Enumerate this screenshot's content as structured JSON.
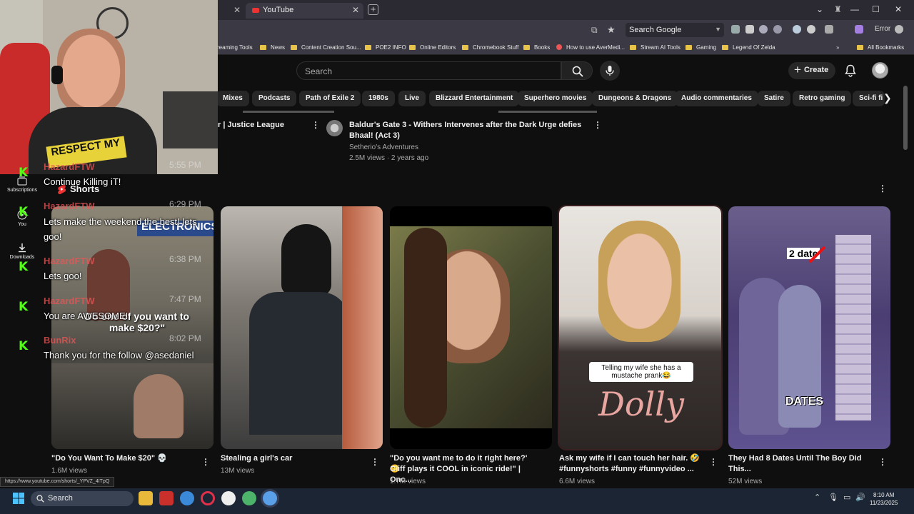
{
  "browser": {
    "tab_title": "YouTube",
    "search_engine": "Search Google",
    "error_label": "Error",
    "bookmarks": [
      "reaming Tools",
      "News",
      "Content Creation Sou...",
      "POE2 INFO",
      "Online Editors",
      "Chromebook Stuff",
      "Books",
      "How to use AverMedi...",
      "Stream AI Tools",
      "Gaming",
      "Legend Of Zelda",
      "All Bookmarks"
    ]
  },
  "youtube": {
    "search_placeholder": "Search",
    "create_label": "Create",
    "chips": [
      "Mixes",
      "Podcasts",
      "Path of Exile 2",
      "1980s",
      "Live",
      "Blizzard Entertainment",
      "Superhero movies",
      "Dungeons & Dragons",
      "Audio commentaries",
      "Satire",
      "Retro gaming",
      "Sci-fi fi"
    ],
    "sidebar": [
      {
        "label": "Subscriptions",
        "icon": "subscriptions-icon"
      },
      {
        "label": "You",
        "icon": "you-icon"
      },
      {
        "label": "Downloads",
        "icon": "download-icon"
      }
    ],
    "top_videos": [
      {
        "title": "r | Justice League"
      },
      {
        "title_line1": "Baldur's Gate 3 - Withers Intervenes after the Dark Urge defies",
        "title_line2": "Bhaal! (Act 3)",
        "channel": "Setherio's Adventures",
        "meta": "2.5M views · 2 years ago"
      }
    ],
    "shorts_header": "Shorts",
    "shorts": [
      {
        "title_line1": "\"Do You Want To Make $20\" 💀",
        "title_line2": "",
        "views": "1.6M views",
        "caption": "Do one of you want to make $20?\""
      },
      {
        "title_line1": "Stealing a girl's car",
        "title_line2": "",
        "views": "13M views"
      },
      {
        "title_line1": "\"Do you want me to do it right here?' 😊",
        "title_line2": "Cliff plays it COOL in iconic ride!\" | Onc...",
        "views": "1.7M views"
      },
      {
        "title_line1": "Ask my wife if I can touch her hair. 🤣",
        "title_line2": "#funnyshorts #funny #funnyvideo ...",
        "views": "6.6M views",
        "caption_line1": "Telling my wife she has a",
        "caption_line2": "mustache prank😂"
      },
      {
        "title_line1": "They Had 8 Dates Until The Boy Did",
        "title_line2": "This...",
        "views": "52M views",
        "badge_top": "2 date",
        "badge_bottom": "DATES"
      }
    ]
  },
  "chat": [
    {
      "user": "HazardFTW",
      "msg": "Continue Killing iT!",
      "time": "5:55 PM"
    },
    {
      "user": "HazardFTW",
      "msg": "Lets make the weekend the best! lets goo!",
      "time": "6:29 PM"
    },
    {
      "user": "HazardFTW",
      "msg": "Lets goo!",
      "time": "6:38 PM"
    },
    {
      "user": "HazardFTW",
      "msg": "You are AWESOME!",
      "time": "7:47 PM"
    },
    {
      "user": "BunRix",
      "msg": "Thank you for the follow @asedaniel",
      "time": "8:02 PM"
    }
  ],
  "status_url": "https://www.youtube.com/shorts/_YPVZ_4ITpQ",
  "taskbar": {
    "search_label": "Search",
    "time": "8:10 AM",
    "date": "11/23/2025"
  }
}
